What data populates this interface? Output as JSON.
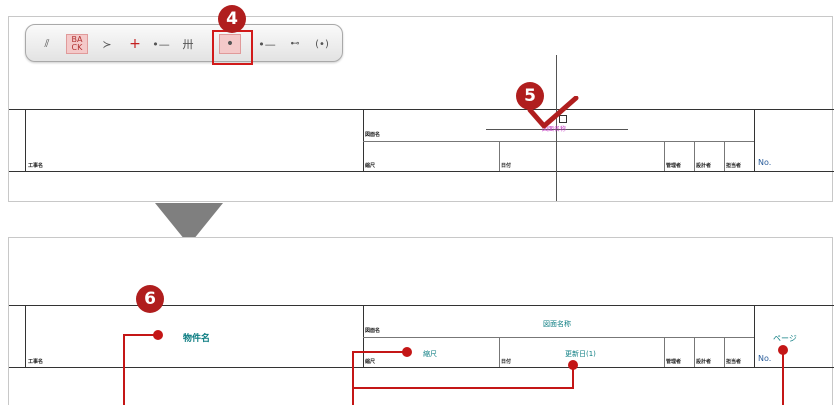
{
  "toolbar": {
    "buttons": [
      {
        "icon": "parallel-lines-icon",
        "glyph": "//."
      },
      {
        "icon": "back-icon",
        "glyph": "BACK"
      },
      {
        "icon": "arrow-snap-icon",
        "glyph": "≻"
      },
      {
        "icon": "cross-point-icon",
        "glyph": "+"
      },
      {
        "icon": "end-point-icon",
        "glyph": "•—"
      },
      {
        "icon": "grid-icon",
        "glyph": "卅"
      },
      {
        "icon": "point-icon",
        "glyph": "•"
      },
      {
        "icon": "mid-point-icon",
        "glyph": "—•—"
      },
      {
        "icon": "distance-icon",
        "glyph": "⊷"
      },
      {
        "icon": "center-icon",
        "glyph": "(•)"
      }
    ]
  },
  "badges": {
    "step4": "4",
    "step5": "5",
    "step6": "6"
  },
  "titleblock": {
    "drawing_name_label": "図面名",
    "scale_label": "縮尺",
    "date_label": "日付",
    "approver_label": "管理者",
    "designer_label": "設計者",
    "charge_label": "担当者",
    "project_label": "工事名",
    "no_label": "No."
  },
  "top_panel": {
    "placed_label": "図面名称"
  },
  "bottom_panel": {
    "drawing_title": "図面名称",
    "property_name": "物件名",
    "scale_value": "縮尺",
    "update_date": "更新日(1)",
    "page": "ページ"
  },
  "colors": {
    "accent_red": "#c41616",
    "field_teal": "#0c7d82",
    "arrow_gray": "#7f7f7f"
  }
}
